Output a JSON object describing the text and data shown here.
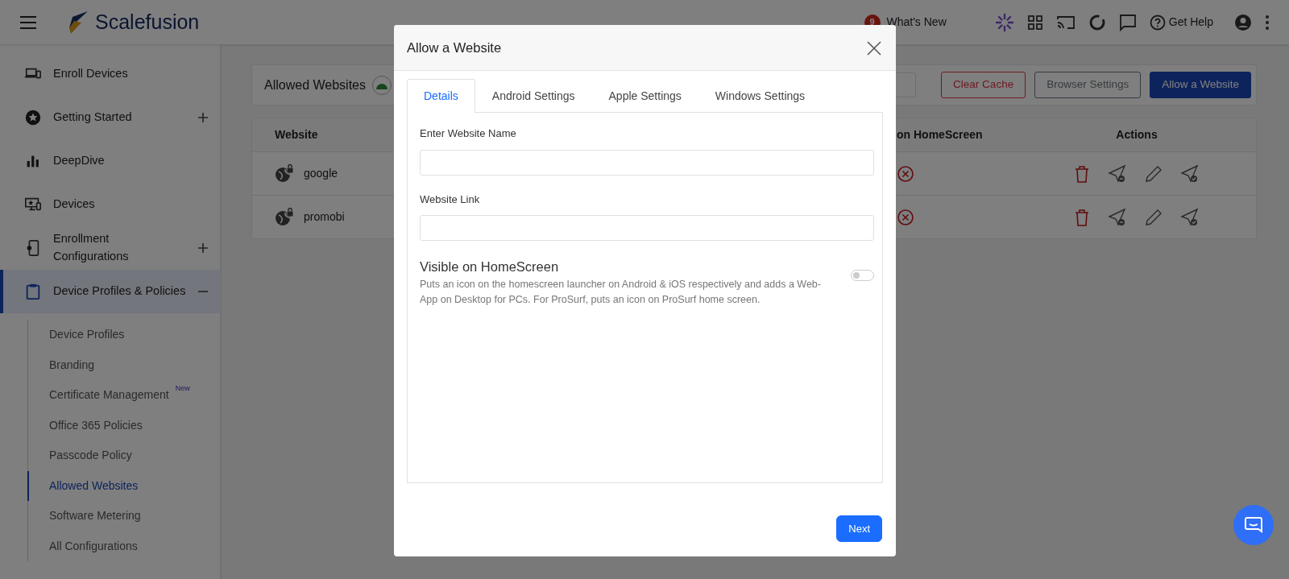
{
  "topbar": {
    "brand": "Scalefusion",
    "whats_new": {
      "badge": "9",
      "label": "What's New"
    },
    "help": "Get Help"
  },
  "sidebar": {
    "items": [
      {
        "label": "Enroll Devices",
        "kind": "link",
        "selected": false
      },
      {
        "label": "Getting Started",
        "kind": "group",
        "expanded": false,
        "selected": false
      },
      {
        "label": "DeepDive",
        "kind": "link",
        "selected": false
      },
      {
        "label": "Devices",
        "kind": "link",
        "selected": false
      },
      {
        "label": "Enrollment Configurations",
        "kind": "group",
        "expanded": false,
        "selected": false
      },
      {
        "label": "Device Profiles & Policies",
        "kind": "group",
        "expanded": true,
        "selected": true,
        "children": [
          {
            "label": "Device Profiles",
            "selected": false
          },
          {
            "label": "Branding",
            "selected": false
          },
          {
            "label": "Certificate Management",
            "badge": "New",
            "selected": false
          },
          {
            "label": "Office 365 Policies",
            "selected": false
          },
          {
            "label": "Passcode Policy",
            "selected": false
          },
          {
            "label": "Allowed Websites",
            "selected": true
          },
          {
            "label": "Software Metering",
            "selected": false
          },
          {
            "label": "All Configurations",
            "selected": false
          }
        ]
      }
    ]
  },
  "main": {
    "title": "Allowed Websites",
    "buttons": [
      {
        "label": "Clear Cache",
        "kind": "outline-danger"
      },
      {
        "label": "Browser Settings",
        "kind": "outline-secondary"
      },
      {
        "label": "Allow a Website",
        "kind": "primary"
      }
    ],
    "table": {
      "columns": [
        "Website",
        "on HomeScreen",
        "Actions"
      ],
      "rows": [
        {
          "website": "google",
          "visible": false
        },
        {
          "website": "promobi",
          "visible": false
        }
      ]
    }
  },
  "modal": {
    "title": "Allow a Website",
    "tabs": [
      {
        "label": "Details",
        "selected": true
      },
      {
        "label": "Android Settings",
        "selected": false
      },
      {
        "label": "Apple Settings",
        "selected": false
      },
      {
        "label": "Windows Settings",
        "selected": false
      }
    ],
    "fields": [
      {
        "label": "Enter Website Name"
      },
      {
        "label": "Website Link"
      }
    ],
    "toggle": {
      "title": "Visible on HomeScreen",
      "description": "Puts an icon on the homescreen launcher on Android & iOS respectively and adds a Web-App on Desktop for PCs. For ProSurf, puts an icon on ProSurf home screen.",
      "on": false
    },
    "next": "Next"
  }
}
